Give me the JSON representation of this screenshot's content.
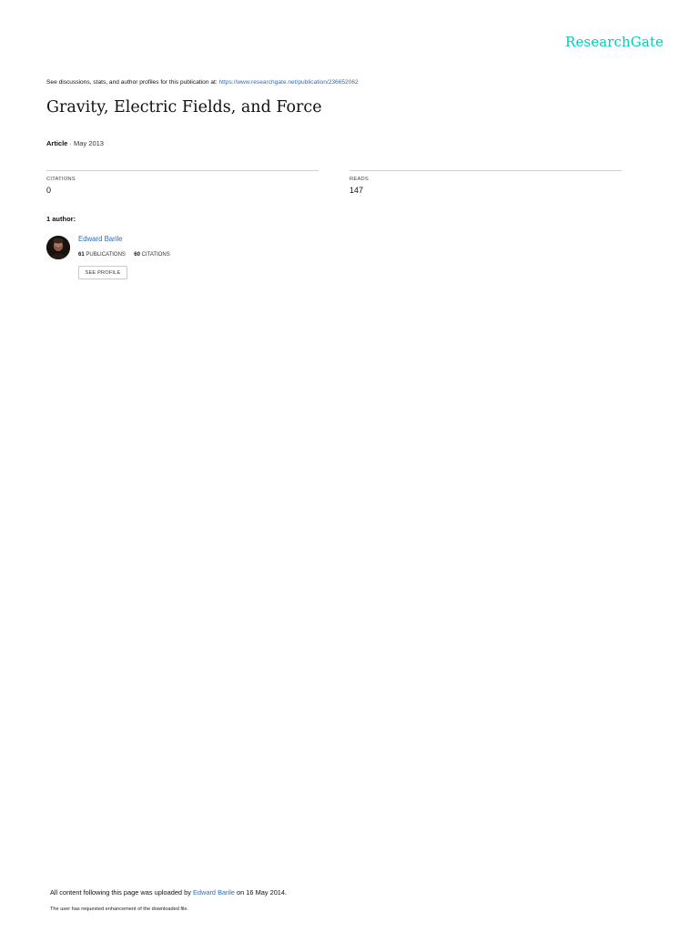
{
  "header": {
    "logo_text": "ResearchGate",
    "discuss_prefix": "See discussions, stats, and author profiles for this publication at: ",
    "publication_url": "https://www.researchgate.net/publication/236652062"
  },
  "publication": {
    "title": "Gravity, Electric Fields, and Force",
    "type": "Article",
    "date": "· May 2013"
  },
  "stats": {
    "citations_label": "CITATIONS",
    "citations_value": "0",
    "reads_label": "READS",
    "reads_value": "147"
  },
  "authors": {
    "heading": "1 author:",
    "list": [
      {
        "name": "Edward Barile",
        "publications_count": "61",
        "publications_label": "PUBLICATIONS",
        "citations_count": "60",
        "citations_label": "CITATIONS",
        "profile_button": "SEE PROFILE"
      }
    ]
  },
  "footer": {
    "upload_prefix": "All content following this page was uploaded by ",
    "uploader": "Edward Barile",
    "upload_suffix": " on 16 May 2014.",
    "note": "The user has requested enhancement of the downloaded file."
  },
  "colors": {
    "brand": "#00ccbb",
    "link": "#2a6ebb"
  }
}
